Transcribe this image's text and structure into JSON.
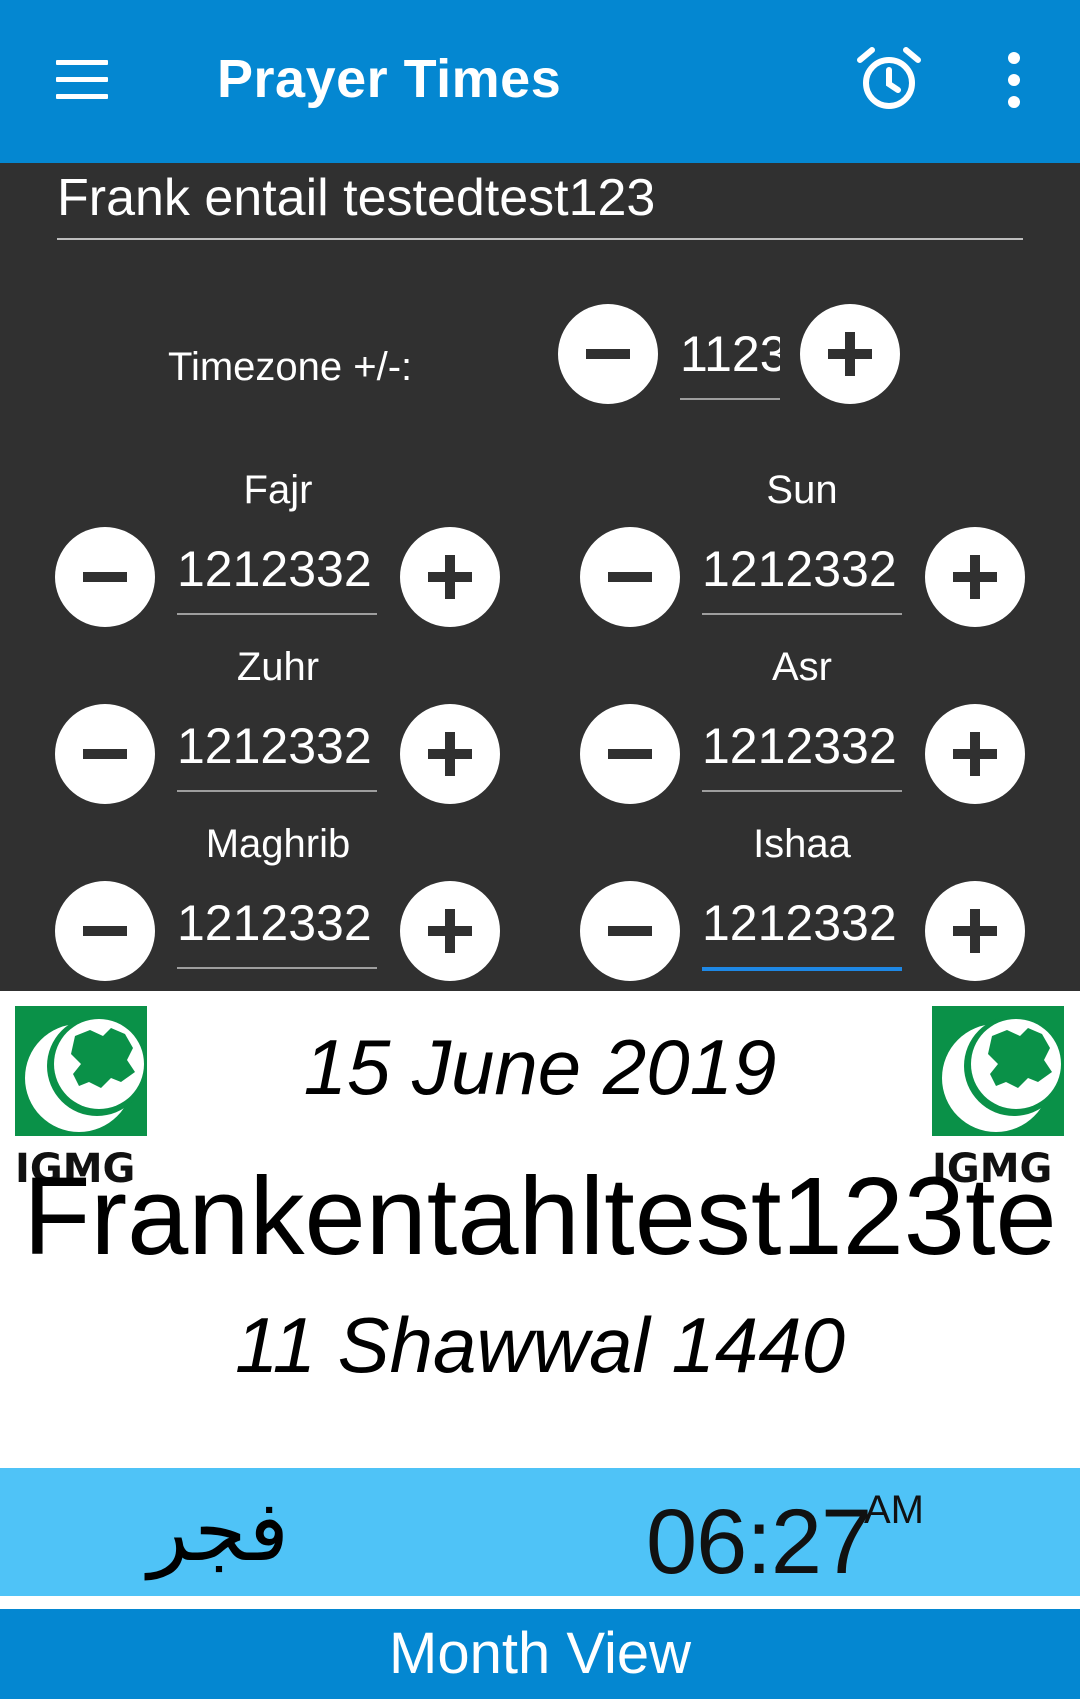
{
  "app_bar": {
    "title": "Prayer Times",
    "menu_icon": "hamburger-menu-icon",
    "alarm_icon": "alarm-clock-icon",
    "overflow_icon": "more-vert-icon"
  },
  "settings": {
    "name_value": "Frank entail testedtest123",
    "timezone": {
      "label": "Timezone +/-:",
      "value": "1123"
    },
    "prayers": [
      {
        "label": "Fajr",
        "value": "1212332"
      },
      {
        "label": "Sun",
        "value": "1212332"
      },
      {
        "label": "Zuhr",
        "value": "1212332"
      },
      {
        "label": "Asr",
        "value": "1212332"
      },
      {
        "label": "Maghrib",
        "value": "1212332"
      },
      {
        "label": "Ishaa",
        "value": "1212332"
      }
    ]
  },
  "header": {
    "logo_text": "IGMG",
    "gregorian_date": "15 June 2019",
    "city": "Frankentahltest123te",
    "hijri_date": "11 Shawwal 1440"
  },
  "current_prayer": {
    "name_arabic": "فجر",
    "time": "06:27",
    "ampm": "AM"
  },
  "footer": {
    "month_view_label": "Month View"
  },
  "colors": {
    "primary": "#0487d1",
    "dark_panel": "#303030",
    "prayer_bar": "#4fc3f7",
    "active_underline": "#1e88e5",
    "logo_green": "#0a9148"
  }
}
